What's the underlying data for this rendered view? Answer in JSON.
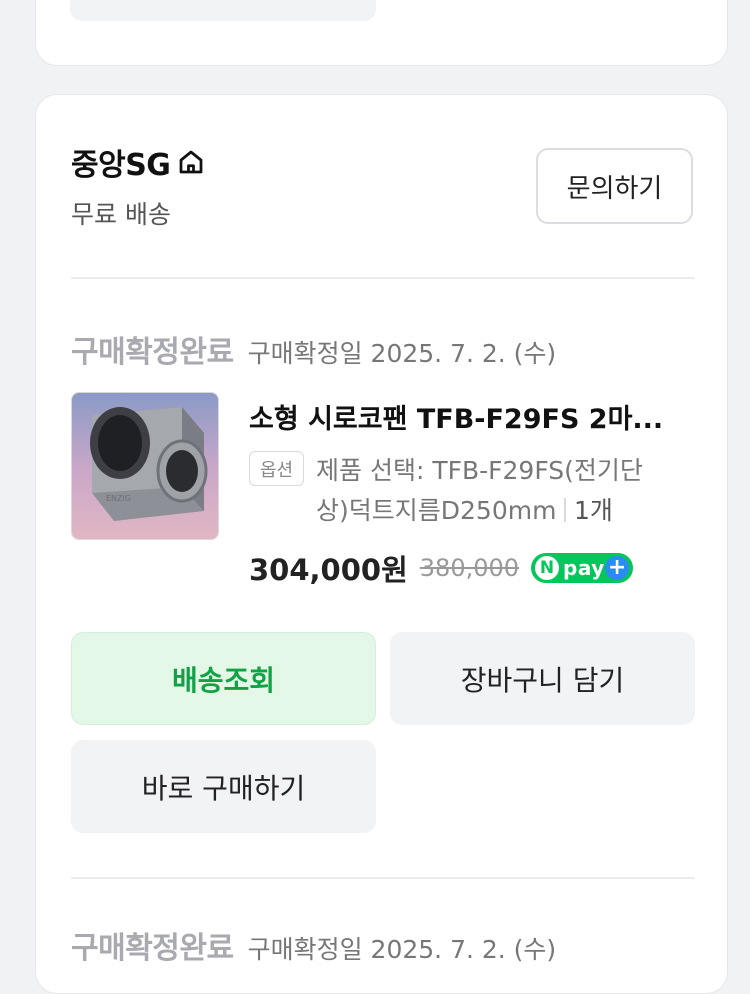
{
  "seller": {
    "name": "중앙SG",
    "shipping": "무료 배송",
    "inquiry_label": "문의하기"
  },
  "order": {
    "status": "구매확정완료",
    "confirm_date": "구매확정일 2025. 7. 2. (수)",
    "product": {
      "title": "소형 시로코팬 TFB-F29FS 2마...",
      "option_badge": "옵션",
      "option_text": "제품 선택: TFB-F29FS(전기단상)덕트지름D250mm",
      "quantity": "1개",
      "price": "304,000원",
      "original_price": "380,000"
    },
    "npay": {
      "n": "N",
      "text": "pay",
      "plus": "+"
    },
    "buttons": {
      "track": "배송조회",
      "cart": "장바구니 담기",
      "buy": "바로 구매하기"
    }
  },
  "next_order": {
    "status": "구매확정완료",
    "confirm_date": "구매확정일 2025. 7. 2. (수)"
  },
  "colors": {
    "background": "#f1f2f4",
    "track_button_bg": "#e3f8e7",
    "track_button_text": "#12a246",
    "npay_green": "#03c75a",
    "npay_blue": "#2a8bf2"
  },
  "icons": [
    "home-icon"
  ]
}
